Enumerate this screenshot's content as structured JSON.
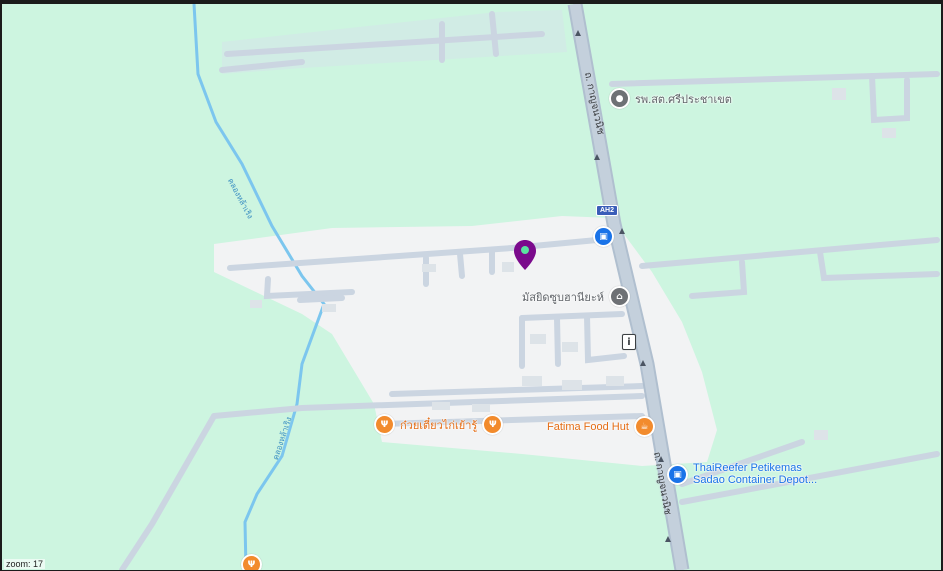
{
  "zoom_label": "zoom: 17",
  "colors": {
    "land": "#cdf5e0",
    "urban": "#f2f3f4",
    "road_minor": "#cbd5e1",
    "road_major": "#b0bfcf",
    "canal": "#7cc6ee",
    "restaurant": "#f28b2d",
    "transit": "#1a73e8",
    "marker": "#7b0a8c"
  },
  "roads": [
    {
      "name": "ถ. กาญจนวนิช",
      "labels": [
        "ถ. กาญจนวนิช",
        "ถ. กาญจนวนิช"
      ],
      "shield": "AH2"
    }
  ],
  "canal": {
    "name": "คลองหล้าเริง",
    "labels": [
      "คลองหล้าเริง",
      "คลองหล้าเริง"
    ]
  },
  "pois": [
    {
      "id": "hospital",
      "label": "รพ.สต.ศรีประชาเขต",
      "icon": "hospital-pin-icon",
      "glyph": "●",
      "color": "#6e7175"
    },
    {
      "id": "mosque",
      "label": "มัสยิดซูบฮานียะห์",
      "icon": "mosque-icon",
      "glyph": "⌂",
      "color": "#6e7175"
    },
    {
      "id": "noodle",
      "label": "ก๋วยเตี๋ยวไก่เย้ารู้",
      "icon": "restaurant-icon",
      "glyph": "Ψ",
      "color": "#f28b2d"
    },
    {
      "id": "fatima",
      "label": "Fatima Food Hut",
      "icon": "cafe-icon",
      "glyph": "☕",
      "color": "#f28b2d"
    },
    {
      "id": "thaireefer",
      "label": "ThaiReefer Petikemas Sadao Container Depot...",
      "label_line1": "ThaiReefer Petikemas",
      "label_line2": "Sadao Container Depot...",
      "icon": "depot-lock-icon",
      "glyph": "▣",
      "color": "#1a73e8"
    }
  ],
  "extra_icons": [
    {
      "id": "transit-top",
      "icon": "lock-icon",
      "glyph": "▣",
      "color": "#1a73e8"
    },
    {
      "id": "info",
      "icon": "info-icon",
      "glyph": "i",
      "color": "#3c4043"
    },
    {
      "id": "restaurant-bottom",
      "icon": "restaurant-icon",
      "glyph": "Ψ",
      "color": "#f28b2d"
    }
  ],
  "marker": {
    "icon": "location-marker-icon",
    "color": "#7b0a8c"
  }
}
